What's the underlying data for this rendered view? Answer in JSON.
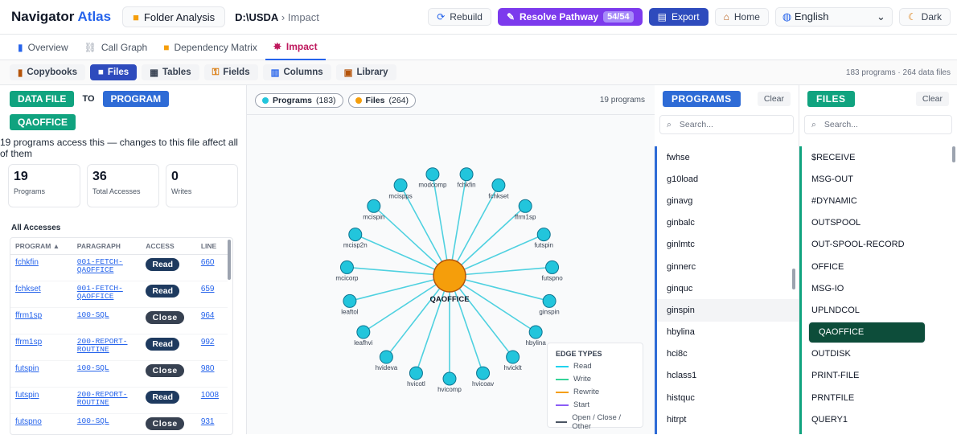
{
  "app": {
    "brand_a": "Navigator",
    "brand_b": "Atlas",
    "folder_btn": "Folder Analysis",
    "path_root": "D:\\USDA",
    "path_sep": "›",
    "path_leaf": "Impact"
  },
  "toolbar": {
    "rebuild": "Rebuild",
    "resolve": "Resolve Pathway",
    "resolve_count": "54/54",
    "export": "Export",
    "home": "Home",
    "language": "English",
    "theme": "Dark"
  },
  "tabs": [
    {
      "label": "Overview"
    },
    {
      "label": "Call Graph"
    },
    {
      "label": "Dependency Matrix"
    },
    {
      "label": "Impact"
    }
  ],
  "subtabs": [
    {
      "label": "Copybooks"
    },
    {
      "label": "Files"
    },
    {
      "label": "Tables"
    },
    {
      "label": "Fields"
    },
    {
      "label": "Columns"
    },
    {
      "label": "Library"
    }
  ],
  "summary": "183 programs · 264 data files",
  "left": {
    "from": "DATA FILE",
    "to_word": "TO",
    "to": "PROGRAM",
    "selected": "QAOFFICE",
    "desc": "19 programs access this — changes to this file affect all of them",
    "cards": [
      {
        "n": "19",
        "l": "Programs"
      },
      {
        "n": "36",
        "l": "Total Accesses"
      },
      {
        "n": "0",
        "l": "Writes"
      }
    ],
    "section": "All Accesses",
    "headers": {
      "program": "PROGRAM ▲",
      "paragraph": "PARAGRAPH",
      "access": "ACCESS",
      "line": "LINE"
    },
    "rows": [
      {
        "p": "fchkfin",
        "para1": "001-FETCH-",
        "para2": "QAOFFICE",
        "a": "Read",
        "l": "660"
      },
      {
        "p": "fchkset",
        "para1": "001-FETCH-",
        "para2": "QAOFFICE",
        "a": "Read",
        "l": "659"
      },
      {
        "p": "ffrm1sp",
        "para1": "100-SQL",
        "para2": "",
        "a": "Close",
        "l": "964"
      },
      {
        "p": "ffrm1sp",
        "para1": "200-REPORT-",
        "para2": "ROUTINE",
        "a": "Read",
        "l": "992"
      },
      {
        "p": "futspin",
        "para1": "100-SQL",
        "para2": "",
        "a": "Close",
        "l": "980"
      },
      {
        "p": "futspin",
        "para1": "200-REPORT-",
        "para2": "ROUTINE",
        "a": "Read",
        "l": "1008"
      },
      {
        "p": "futspno",
        "para1": "100-SQL",
        "para2": "",
        "a": "Close",
        "l": "931"
      }
    ]
  },
  "graph": {
    "legend_programs": "Programs",
    "programs_count": "(183)",
    "legend_files": "Files",
    "files_count": "(264)",
    "count_text": "19 programs",
    "center": "QAOFFICE",
    "nodes": [
      "fchkfin",
      "fchkset",
      "ffrm1sp",
      "futspin",
      "futspno",
      "ginspin",
      "hbylina",
      "hvicklt",
      "hvicoav",
      "hvicomp",
      "hvicotl",
      "hvideva",
      "leafhvi",
      "leaftol",
      "mcicorp",
      "mcisp2n",
      "mcispin",
      "mcispps",
      "modcomp"
    ],
    "edge_title": "EDGE TYPES",
    "edge_types": [
      {
        "label": "Read",
        "color": "#22d3ee"
      },
      {
        "label": "Write",
        "color": "#34d399"
      },
      {
        "label": "Rewrite",
        "color": "#f59e0b"
      },
      {
        "label": "Start",
        "color": "#8b5cf6"
      },
      {
        "label": "Open / Close / Other",
        "color": "#4b5563"
      }
    ]
  },
  "programs": {
    "title": "PROGRAMS",
    "clear": "Clear",
    "search_placeholder": "Search...",
    "items": [
      "fwhse",
      "g10load",
      "ginavg",
      "ginbalc",
      "ginlmtc",
      "ginnerc",
      "ginquc",
      "ginspin",
      "hbylina",
      "hci8c",
      "hclass1",
      "histquc",
      "hitrpt"
    ]
  },
  "files": {
    "title": "FILES",
    "clear": "Clear",
    "search_placeholder": "Search...",
    "items": [
      "$RECEIVE",
      "MSG-OUT",
      "#DYNAMIC",
      "OUTSPOOL",
      "OUT-SPOOL-RECORD",
      "OFFICE",
      "MSG-IO",
      "UPLNDCOL",
      "QAOFFICE",
      "OUTDISK",
      "PRINT-FILE",
      "PRNTFILE",
      "QUERY1"
    ]
  }
}
